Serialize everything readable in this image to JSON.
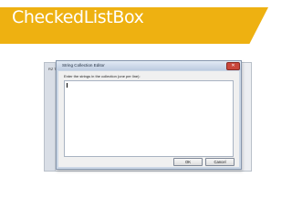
{
  "banner": {
    "title": "CheckedListBox",
    "color": "#eeb111"
  },
  "background_window": {
    "label": "RZ Th..."
  },
  "dialog": {
    "title": "String Collection Editor",
    "prompt": "Enter the strings in the collection (one per line):",
    "text_value": "",
    "close_icon": "close-icon",
    "ok_label": "OK",
    "cancel_label": "Cancel"
  }
}
